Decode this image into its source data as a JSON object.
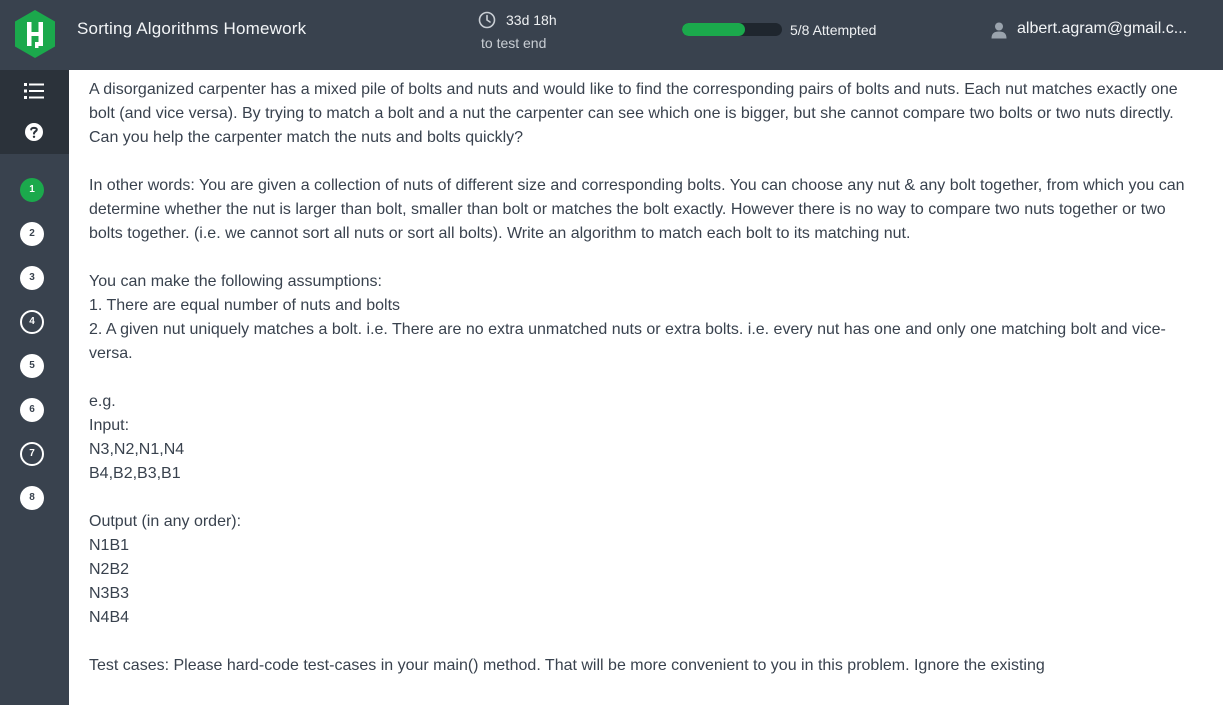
{
  "header": {
    "title": "Sorting Algorithms Homework",
    "timer_value": "33d 18h",
    "timer_caption": "to test end",
    "progress_fraction": 0.625,
    "progress_label": "5/8 Attempted",
    "user_email": "albert.agram@gmail.c...",
    "icons": {
      "logo": "hackerrank-logo-icon",
      "timer": "clock-icon",
      "user": "user-icon"
    }
  },
  "sidebar": {
    "tools": [
      {
        "icon": "list-icon"
      },
      {
        "icon": "help-icon"
      }
    ],
    "questions": [
      {
        "label": "1",
        "state": "current"
      },
      {
        "label": "2",
        "state": "attempted"
      },
      {
        "label": "3",
        "state": "attempted"
      },
      {
        "label": "4",
        "state": "unattempted"
      },
      {
        "label": "5",
        "state": "attempted"
      },
      {
        "label": "6",
        "state": "attempted"
      },
      {
        "label": "7",
        "state": "unattempted"
      },
      {
        "label": "8",
        "state": "attempted"
      }
    ]
  },
  "problem": {
    "intro": "A disorganized carpenter has a mixed pile of bolts and nuts and would like to find the corresponding pairs of bolts and nuts. Each nut matches exactly one bolt (and vice versa). By trying to match a bolt and a nut the carpenter can see which one is bigger, but she cannot compare two bolts or two nuts directly. Can you help the carpenter match the nuts and bolts quickly?",
    "restatement": "In other words: You are given a collection of nuts of different size and corresponding bolts. You can choose any nut & any bolt together, from which you can determine whether the nut is larger than bolt, smaller than bolt or matches the bolt exactly. However there is no way to compare two nuts together or two bolts together. (i.e. we cannot sort all nuts or sort all bolts). Write an algorithm to match each bolt to its matching nut.",
    "assumptions_heading": "You can make the following assumptions:",
    "assumptions": [
      "1. There are equal number of nuts and bolts",
      "2. A given nut uniquely matches a bolt. i.e. There are no extra unmatched nuts or extra bolts. i.e. every nut has one and only one matching bolt and vice-versa."
    ],
    "example_label": "e.g.",
    "input_label": "Input:",
    "input_lines": [
      "N3,N2,N1,N4",
      "B4,B2,B3,B1"
    ],
    "output_label": "Output (in any order):",
    "output_lines": [
      "N1B1",
      "N2B2",
      "N3B3",
      "N4B4"
    ],
    "test_cases": "Test cases: Please hard-code test-cases in your main() method.  That will be more convenient to you in this problem. Ignore the existing"
  },
  "colors": {
    "header_bg": "#39424e",
    "sidebar_tools_bg": "#2b323a",
    "accent_green": "#1ba94c",
    "logo_green": "#1ba94c",
    "text": "#39424e"
  }
}
